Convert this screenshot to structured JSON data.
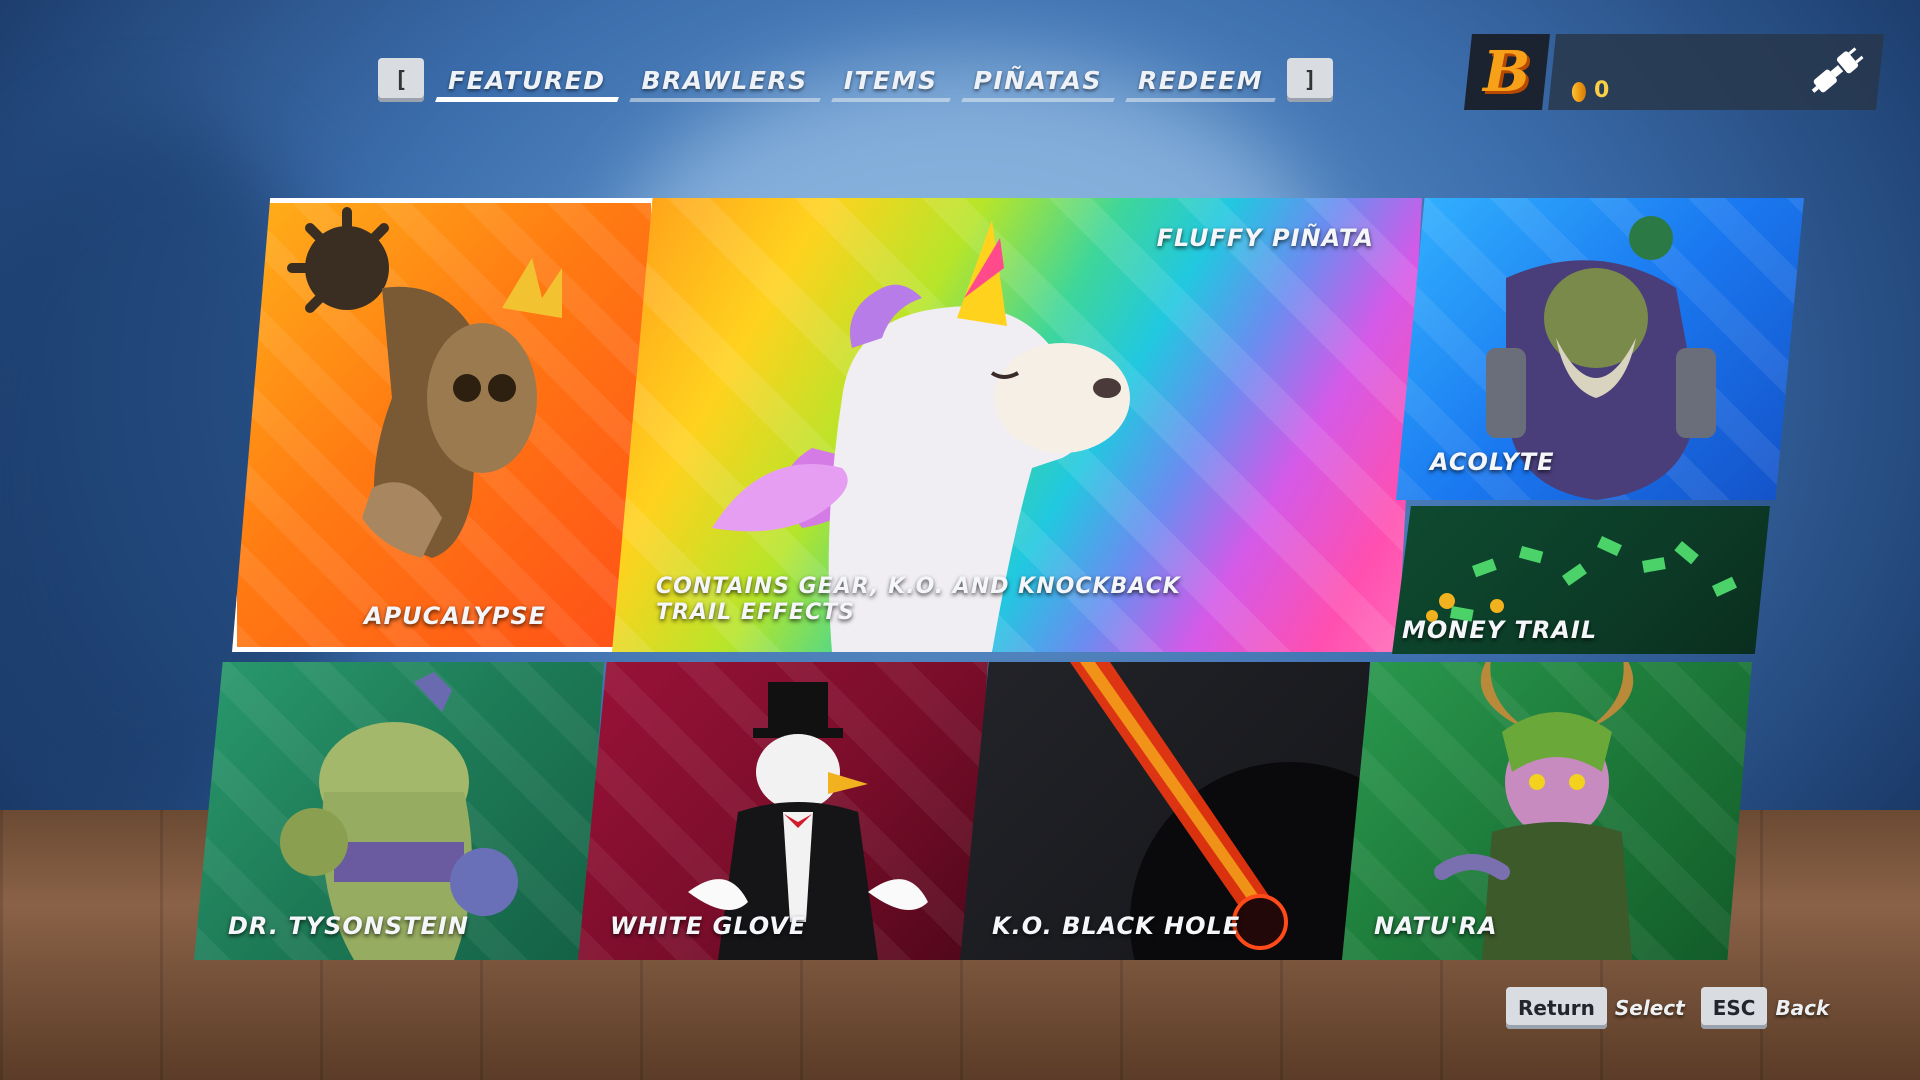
{
  "tabs": {
    "left_bracket": "[",
    "right_bracket": "]",
    "items": [
      {
        "label": "FEATURED",
        "active": true
      },
      {
        "label": "BRAWLERS",
        "active": false
      },
      {
        "label": "ITEMS",
        "active": false
      },
      {
        "label": "PIÑATAS",
        "active": false
      },
      {
        "label": "REDEEM",
        "active": false
      }
    ]
  },
  "wallet": {
    "brand_letter": "B",
    "coins": "0",
    "icons": {
      "brand": "brawlhalla-b-logo",
      "coin": "coin-icon",
      "connection": "plug-icon"
    }
  },
  "tiles": {
    "apucalypse": {
      "label": "APUCALYPSE",
      "color": "#ff6a1a"
    },
    "fluffy_pinata": {
      "title": "FLUFFY PIÑATA",
      "description_line1": "CONTAINS GEAR, K.O. AND KNOCKBACK",
      "description_line2": "TRAIL EFFECTS"
    },
    "acolyte": {
      "label": "ACOLYTE",
      "color": "#1e6fe0"
    },
    "money_trail": {
      "label": "MONEY TRAIL",
      "color": "#0f5a38"
    },
    "dr_tysonstein": {
      "label": "DR. TYSONSTEIN",
      "color": "#1d7a56"
    },
    "white_glove": {
      "label": "WHITE GLOVE",
      "color": "#7a0d2a"
    },
    "ko_black_hole": {
      "label": "K.O. BLACK HOLE",
      "color": "#1a1b1f"
    },
    "natura": {
      "label": "NATU'RA",
      "color": "#1d7a3a"
    }
  },
  "footer": {
    "select_key": "Return",
    "select_label": "Select",
    "back_key": "ESC",
    "back_label": "Back"
  }
}
